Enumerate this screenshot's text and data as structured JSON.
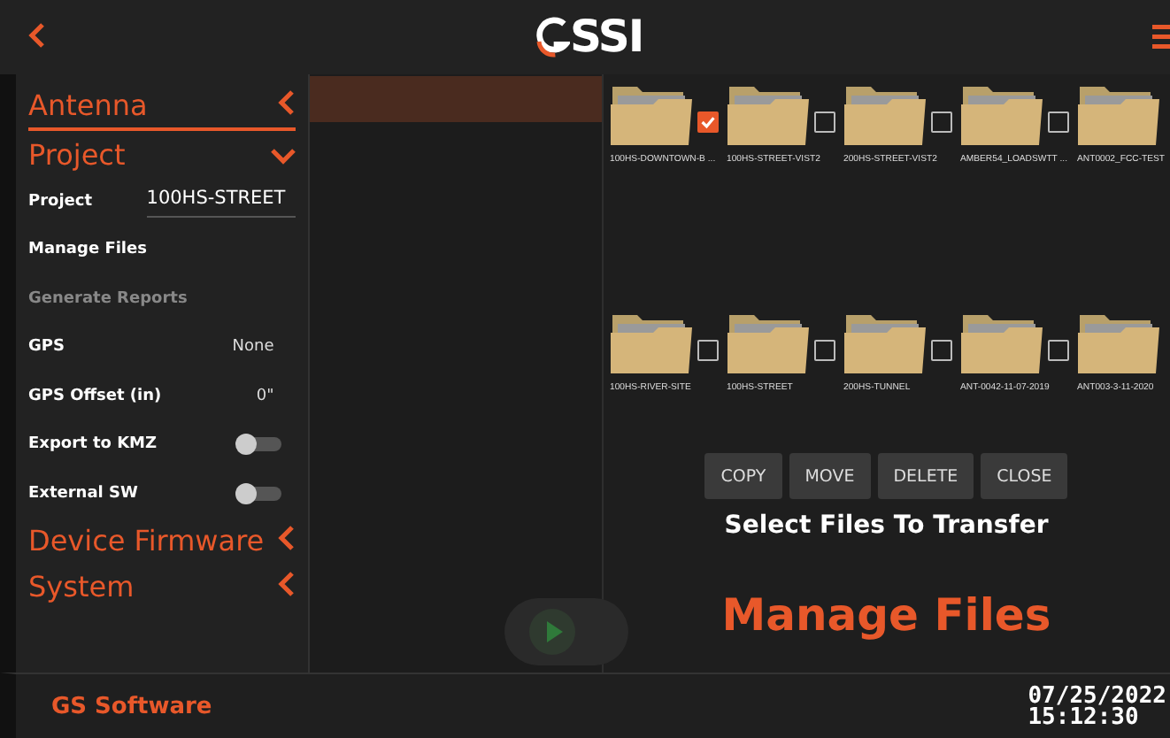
{
  "top_bar": {
    "logo": "SSI"
  },
  "sidebar": {
    "sections": [
      {
        "title": "Antenna",
        "expanded": false,
        "selected": true
      },
      {
        "title": "Project",
        "expanded": true,
        "selected": false,
        "items": [
          {
            "kind": "field",
            "label": "Project",
            "value": "100HS-STREET"
          },
          {
            "kind": "link",
            "label": "Manage Files",
            "disabled": false
          },
          {
            "kind": "link",
            "label": "Generate Reports",
            "disabled": true
          },
          {
            "kind": "value",
            "label": "GPS",
            "value": "None"
          },
          {
            "kind": "value",
            "label": "GPS Offset (in)",
            "value": "0\""
          },
          {
            "kind": "toggle",
            "label": "Export to KMZ",
            "on": false
          },
          {
            "kind": "toggle",
            "label": "External SW",
            "on": false
          }
        ]
      },
      {
        "title": "Device Firmware",
        "expanded": false,
        "selected": false
      },
      {
        "title": "System",
        "expanded": false,
        "selected": false
      }
    ]
  },
  "file_manager": {
    "files": [
      {
        "name": "100HS-DOWNTOWN-B ...",
        "checked": true
      },
      {
        "name": "100HS-STREET-VIST2",
        "checked": false
      },
      {
        "name": "200HS-STREET-VIST2",
        "checked": false
      },
      {
        "name": "AMBER54_LOADSWTT ...",
        "checked": false
      },
      {
        "name": "ANT0002_FCC-TEST"
      },
      {
        "name": "100HS-RIVER-SITE",
        "checked": false
      },
      {
        "name": "100HS-STREET",
        "checked": false
      },
      {
        "name": "200HS-TUNNEL",
        "checked": false
      },
      {
        "name": "ANT-0042-11-07-2019",
        "checked": false
      },
      {
        "name": "ANT003-3-11-2020"
      }
    ],
    "buttons": [
      "COPY",
      "MOVE",
      "DELETE",
      "CLOSE"
    ],
    "instruction": "Select Files To Transfer",
    "title": "Manage Files"
  },
  "status_bar": {
    "app_name": "GS Software",
    "date": "07/25/2022",
    "time": "15:12:30"
  }
}
